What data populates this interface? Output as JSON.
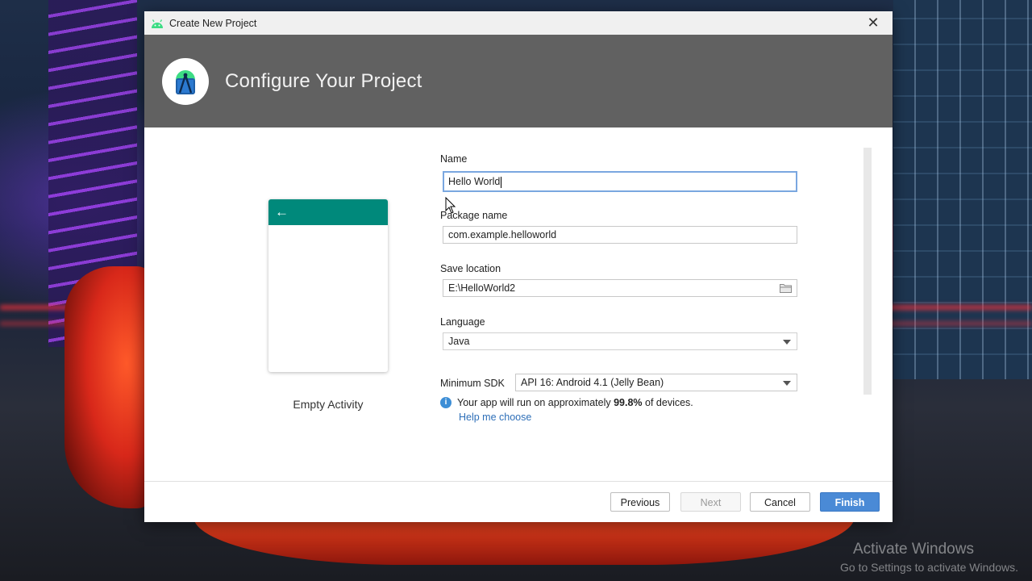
{
  "dialog": {
    "window_title": "Create New Project",
    "close_glyph": "✕",
    "heading": "Configure Your Project"
  },
  "preview": {
    "back_glyph": "←",
    "template_label": "Empty Activity",
    "toolbar_color": "#00897b"
  },
  "form": {
    "name_label": "Name",
    "name_value": "Hello World",
    "package_label": "Package name",
    "package_value": "com.example.helloworld",
    "location_label": "Save location",
    "location_value": "E:\\HelloWorld2",
    "language_label": "Language",
    "language_value": "Java",
    "min_sdk_label": "Minimum SDK",
    "min_sdk_value": "API 16: Android 4.1 (Jelly Bean)",
    "info_prefix": "Your app will run on approximately ",
    "info_percent": "99.8%",
    "info_suffix": " of devices.",
    "help_link": "Help me choose"
  },
  "buttons": {
    "previous": "Previous",
    "next": "Next",
    "cancel": "Cancel",
    "finish": "Finish"
  },
  "desktop": {
    "watermark_title": "Activate Windows",
    "watermark_subtitle": "Go to Settings to activate Windows."
  },
  "colors": {
    "banner": "#616161",
    "accent": "#4a8ad6",
    "link": "#2e6fb8",
    "info_icon": "#3d8ed6"
  },
  "icons": [
    "android-icon",
    "close-icon",
    "android-studio-logo-icon",
    "back-arrow-icon",
    "folder-icon",
    "dropdown-arrow-icon",
    "info-icon",
    "mouse-pointer-icon"
  ]
}
